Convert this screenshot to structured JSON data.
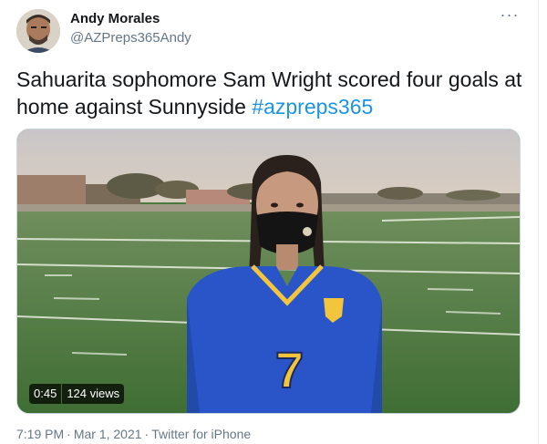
{
  "tweet": {
    "author_name": "Andy Morales",
    "author_handle": "@AZPreps365Andy",
    "more_icon": "more-horizontal-icon",
    "text_before_hashtag": "Sahuarita sophomore Sam Wright scored four goals at home against Sunnyside ",
    "hashtag": "#azpreps365",
    "video": {
      "duration": "0:45",
      "views": "124 views",
      "jersey_number": "7"
    },
    "time": "7:19 PM",
    "date": "Mar 1, 2021",
    "source": "Twitter for iPhone",
    "separator": "·"
  },
  "colors": {
    "link": "#1b95e0",
    "secondary_text": "#657786",
    "primary_text": "#14171a",
    "jersey": "#2a55c8",
    "number": "#f2c53d"
  }
}
